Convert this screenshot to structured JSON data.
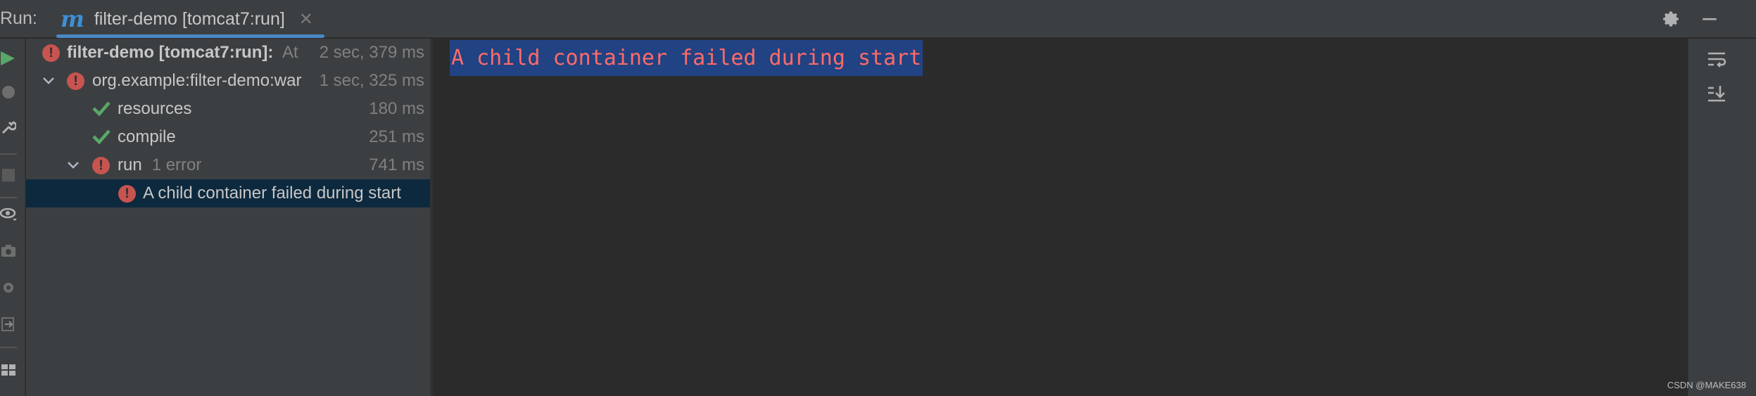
{
  "header": {
    "run_label": "Run:",
    "tab": {
      "logo_icon": "maven-m-icon",
      "logo_glyph": "m",
      "title": "filter-demo [tomcat7:run]",
      "close_glyph": "✕"
    },
    "settings_icon": "gear-icon",
    "minimize_icon": "minimize-icon"
  },
  "left_toolbar": {
    "icons": [
      "rerun-icon",
      "stop-icon",
      "wrench-icon",
      "stop-square-icon",
      "eye-icon",
      "camera-icon",
      "gear-debug-icon",
      "export-icon",
      "layout-icon"
    ]
  },
  "tree": {
    "rows": [
      {
        "label": "filter-demo [tomcat7:run]:",
        "suffix": "At",
        "time": "2 sec, 379 ms",
        "status": "error"
      },
      {
        "label": "org.example:filter-demo:war",
        "time": "1 sec, 325 ms",
        "status": "error"
      },
      {
        "label": "resources",
        "time": "180 ms",
        "status": "ok"
      },
      {
        "label": "compile",
        "time": "251 ms",
        "status": "ok"
      },
      {
        "label": "run",
        "suffix": "1 error",
        "time": "741 ms",
        "status": "error"
      },
      {
        "label": "A child container failed during start",
        "status": "error"
      }
    ]
  },
  "console": {
    "lines": [
      "A child container failed during start"
    ]
  },
  "right_toolbar": {
    "icons": [
      "soft-wrap-icon",
      "scroll-to-end-icon"
    ]
  },
  "watermark": "CSDN @MAKE638",
  "colors": {
    "error": "#c75450",
    "ok": "#59a869",
    "selection": "#214283",
    "tab_accent": "#4a88c7"
  }
}
